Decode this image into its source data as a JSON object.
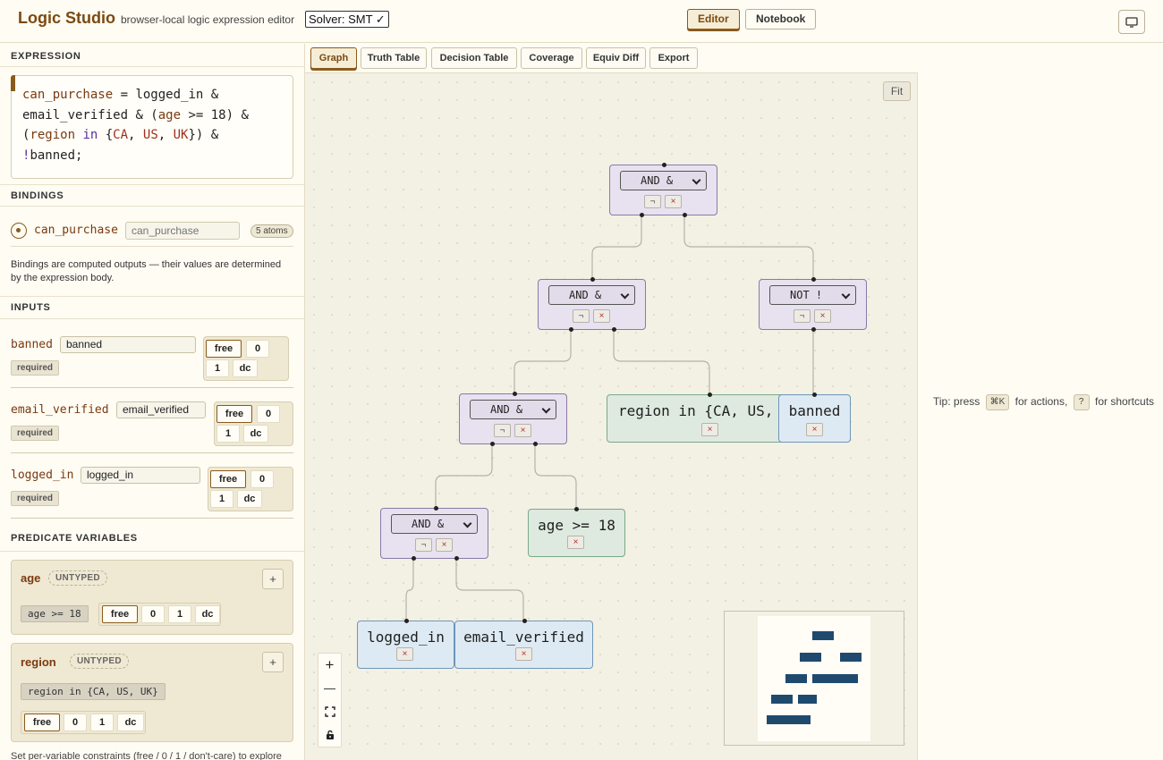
{
  "header": {
    "title": "Logic Studio",
    "subtitle": "browser-local logic expression editor",
    "solver": "Solver: SMT ✓",
    "nav": [
      "Editor",
      "Notebook"
    ],
    "monitor_icon": "monitor-icon"
  },
  "left": {
    "expression_title": "EXPRESSION",
    "expression": {
      "l1": [
        "can_purchase",
        " = ",
        "logged_in",
        " &"
      ],
      "l2": [
        "email_verified",
        " & (",
        "age",
        " >= 18) &"
      ],
      "l3": [
        "(",
        "region",
        " in",
        " {",
        "CA",
        ", ",
        "US",
        ", ",
        "UK",
        "}) &"
      ],
      "l4": [
        "!",
        "banned;"
      ]
    },
    "bindings_title": "BINDINGS",
    "binding": {
      "name": "can_purchase",
      "placeholder": "can_purchase",
      "badge": "5 atoms"
    },
    "binding_note": "Bindings are computed outputs — their values are determined by the expression body.",
    "inputs_title": "INPUTS",
    "inputs": [
      {
        "name": "banned",
        "value": "banned",
        "badge": "required",
        "opts": [
          "free",
          "0",
          "1",
          "dc"
        ]
      },
      {
        "name": "email_verified",
        "value": "email_verified",
        "badge": "required",
        "opts": [
          "free",
          "0",
          "1",
          "dc"
        ]
      },
      {
        "name": "logged_in",
        "value": "logged_in",
        "badge": "required",
        "opts": [
          "free",
          "0",
          "1",
          "dc"
        ]
      }
    ],
    "predicates_title": "PREDICATE VARIABLES",
    "predicates": [
      {
        "name": "age",
        "type": "UNTYPED",
        "expr": "age >= 18",
        "plus": "+",
        "opts": [
          "free",
          "0",
          "1",
          "dc"
        ]
      },
      {
        "name": "region",
        "type": "UNTYPED",
        "expr": "region in {CA, US, UK}",
        "plus": "+",
        "opts": [
          "free",
          "0",
          "1",
          "dc"
        ]
      }
    ],
    "predicate_note": "Set per-variable constraints (free / 0 / 1 / don't-care) to explore"
  },
  "tabs": [
    "Graph",
    "Truth Table",
    "Decision Table",
    "Coverage",
    "Equiv Diff",
    "Export"
  ],
  "canvas": {
    "fit": "Fit",
    "not_btn": "¬",
    "del_btn": "×",
    "nodes": {
      "root": "AND &",
      "and2": "AND &",
      "not1": "NOT !",
      "and3": "AND &",
      "and4": "AND &",
      "region": "region in {CA, US, UK}",
      "banned": "banned",
      "age": "age >= 18",
      "logged_in": "logged_in",
      "email_verified": "email_verified"
    },
    "zoom": [
      "+",
      "—"
    ]
  },
  "right": {
    "tip_pre": "Tip: press",
    "tip_key1": "⌘K",
    "tip_mid": "for actions,",
    "tip_key2": "?",
    "tip_post": "for shortcuts"
  }
}
